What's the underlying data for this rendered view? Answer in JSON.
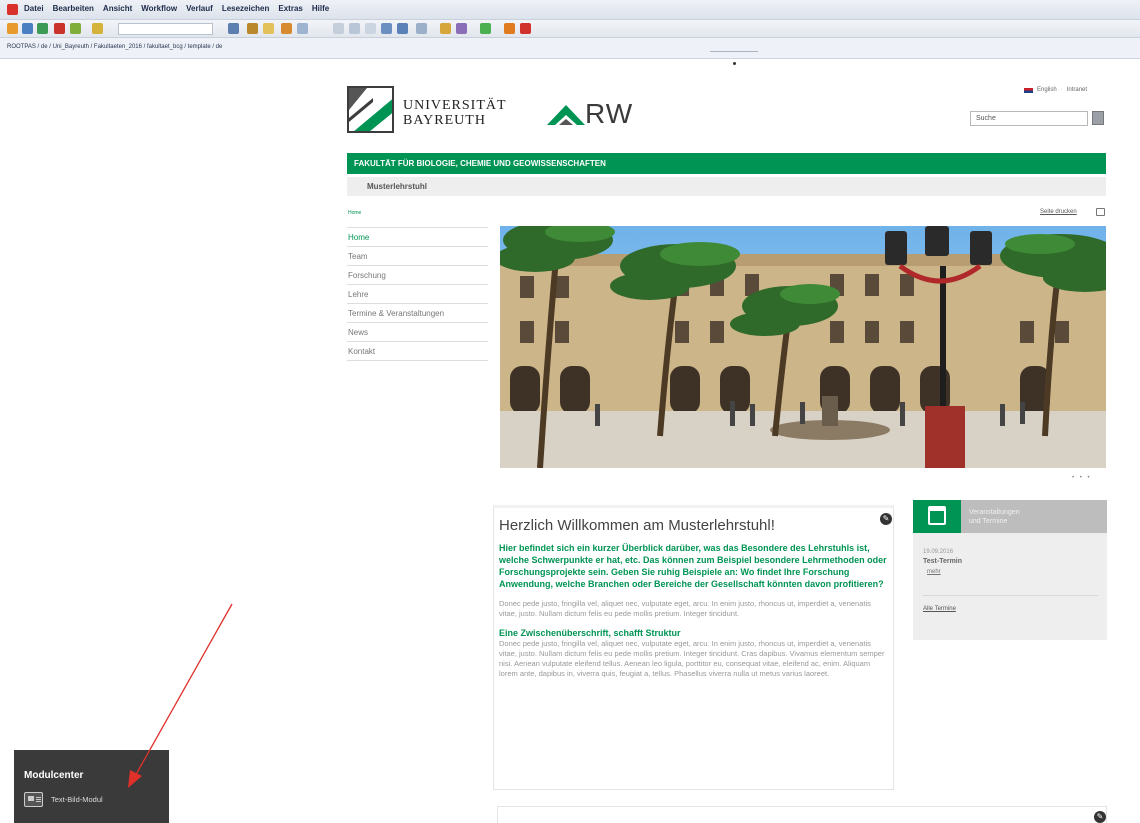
{
  "toolbar": {
    "menu": [
      "Datei",
      "Bearbeiten",
      "Ansicht",
      "Workflow",
      "Verlauf",
      "Lesezeichen",
      "Extras",
      "Hilfe"
    ],
    "path": "ROOTPAS / de / Uni_Bayreuth / Fakultaeten_2016 / fakultaet_bcg / template / de"
  },
  "header": {
    "university_line1": "UNIVERSITÄT",
    "university_line2": "BAYREUTH",
    "rw_logo_text": "RW",
    "lang_english": "English",
    "lang_intranet": "Intranet",
    "search_placeholder": "Suche"
  },
  "faculty_bar": "Fakultät für Biologie, Chemie und Geowissenschaften",
  "chair_title": "Musterlehrstuhl",
  "breadcrumb": "Home",
  "print_label": "Seite drucken",
  "nav": [
    "Home",
    "Team",
    "Forschung",
    "Lehre",
    "Termine & Veranstaltungen",
    "News",
    "Kontakt"
  ],
  "slider_dots": "• • •",
  "welcome": {
    "title": "Herzlich Willkommen am Musterlehrstuhl!",
    "intro": "Hier befindet sich ein kurzer Überblick darüber, was das Besondere des Lehrstuhls ist, welche Schwerpunkte er hat, etc. Das können zum Beispiel besondere Lehrmethoden oder Forschungsprojekte sein. Geben Sie ruhig Beispiele an: Wo findet Ihre Forschung Anwendung, welche Branchen oder Bereiche der Gesellschaft könnten davon profitieren?",
    "paragraph": "Donec pede justo, fringilla vel, aliquet nec, vulputate eget, arcu. In enim justo, rhoncus ut, imperdiet a, venenatis vitae, justo. Nullam dictum felis eu pede mollis pretium. Integer tincidunt.",
    "subheading": "Eine Zwischenüberschrift, schafft Struktur",
    "paragraph2": "Donec pede justo, fringilla vel, aliquet nec, vulputate eget, arcu. In enim justo, rhoncus ut, imperdiet a, venenatis vitae, justo. Nullam dictum felis eu pede mollis pretium. Integer tincidunt. Cras dapibus. Vivamus elementum semper nisi. Aenean vulputate eleifend tellus. Aenean leo ligula, porttitor eu, consequat vitae, eleifend ac, enim. Aliquam lorem ante, dapibus in, viverra quis, feugiat a, tellus. Phasellus viverra nulla ut metus varius laoreet."
  },
  "events": {
    "title_line1": "Veranstaltungen",
    "title_line2": "und Termine",
    "date": "19.09.2016",
    "event_title": "Test-Termin",
    "more": "mehr",
    "all": "Alle Termine"
  },
  "modulcenter": {
    "title": "Modulcenter",
    "item": "Text-Bild-Modul"
  },
  "edit_glyph": "✎",
  "colors": {
    "accent": "#009454",
    "modul_bg": "#3a3a3a",
    "arrow": "#e0302a"
  }
}
